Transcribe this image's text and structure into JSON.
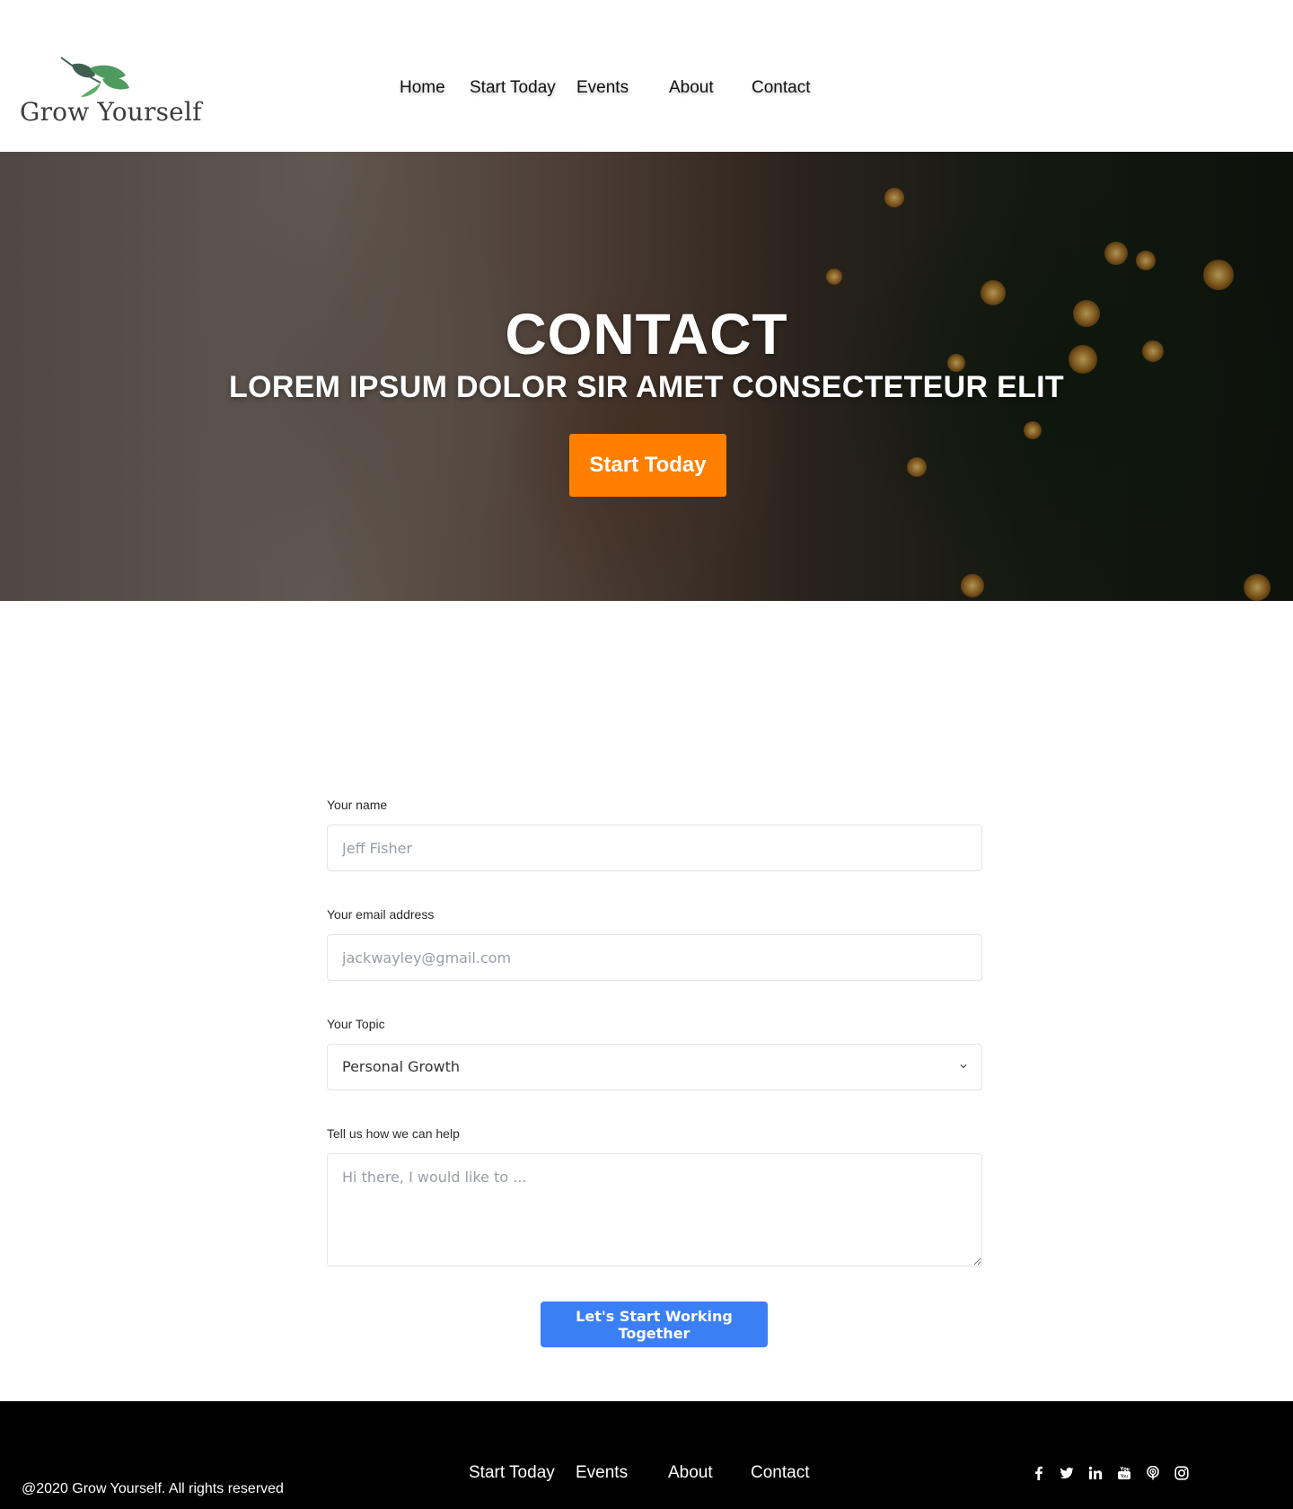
{
  "brand": {
    "name": "Grow Yourself"
  },
  "nav": {
    "items": [
      "Home",
      "Start Today",
      "Events",
      "About",
      "Contact"
    ]
  },
  "hero": {
    "title": "CONTACT",
    "subtitle": "LOREM IPSUM DOLOR SIR AMET CONSECTETEUR ELIT",
    "cta_label": "Start Today"
  },
  "form": {
    "name": {
      "label": "Your name",
      "placeholder": "Jeff Fisher"
    },
    "email": {
      "label": "Your email address",
      "placeholder": "jackwayley@gmail.com"
    },
    "topic": {
      "label": "Your Topic",
      "selected": "Personal Growth"
    },
    "message": {
      "label": "Tell us how we can help",
      "placeholder": "Hi there, I would like to ..."
    },
    "submit_label": "Let's Start Working Together"
  },
  "footer": {
    "nav_items": [
      "Start Today",
      "Events",
      "About",
      "Contact"
    ],
    "copyright": "@2020 Grow Yourself. All rights reserved",
    "social_icons": [
      "facebook-icon",
      "twitter-icon",
      "linkedin-icon",
      "youtube-icon",
      "podcast-icon",
      "instagram-icon"
    ]
  },
  "colors": {
    "accent_orange": "#ff7f00",
    "button_blue": "#3b7ff5",
    "leaf_green": "#4f9a5e",
    "leaf_dark": "#3f5f52",
    "footer_bg": "#000000"
  }
}
